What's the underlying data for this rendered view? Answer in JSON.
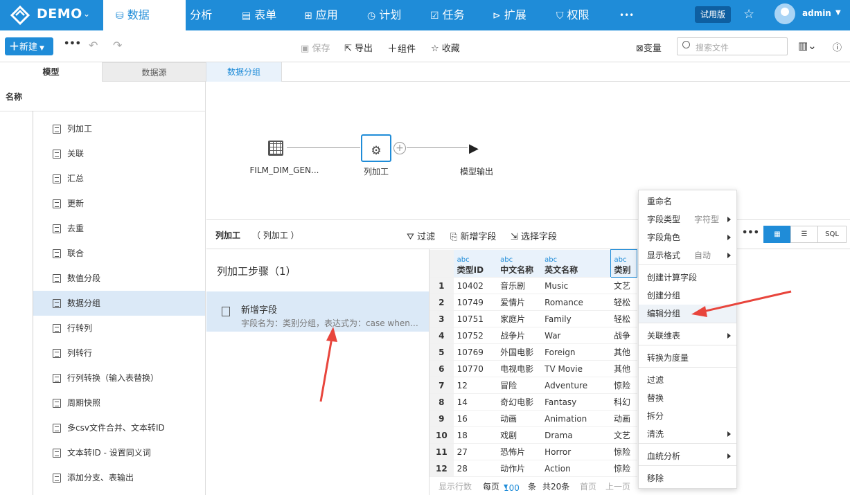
{
  "topbar": {
    "brand": "DEMO",
    "nav": [
      {
        "label": "数据",
        "icon": "database-icon",
        "glyph": "⛁"
      },
      {
        "label": "分析",
        "icon": "chart-icon",
        "glyph": "▥"
      },
      {
        "label": "表单",
        "icon": "form-icon",
        "glyph": "▤"
      },
      {
        "label": "应用",
        "icon": "apps-icon",
        "glyph": "⊞"
      },
      {
        "label": "计划",
        "icon": "clock-icon",
        "glyph": "◷"
      },
      {
        "label": "任务",
        "icon": "task-icon",
        "glyph": "☑"
      },
      {
        "label": "扩展",
        "icon": "extension-icon",
        "glyph": "⊳"
      },
      {
        "label": "权限",
        "icon": "shield-icon",
        "glyph": "⛉"
      }
    ],
    "more": "•••",
    "trial": "试用版",
    "user": "admin"
  },
  "toolbar": {
    "new_label": "新建",
    "more": "•••",
    "save": "保存",
    "export": "导出",
    "component": "组件",
    "favorite": "收藏",
    "variable": "变量",
    "search_placeholder": "搜索文件"
  },
  "left": {
    "tabs": [
      "模型",
      "数据源"
    ],
    "header": "名称",
    "nodes": [
      "列加工",
      "关联",
      "汇总",
      "更新",
      "去重",
      "联合",
      "数值分段",
      "数据分组",
      "行转列",
      "列转行",
      "行列转换（输入表替换）",
      "周期快照",
      "多csv文件合并、文本转ID",
      "文本转ID - 设置同义词",
      "添加分支、表输出"
    ],
    "selected_index": 7
  },
  "center": {
    "tab": "数据分组",
    "flow": {
      "source": "FILM_DIM_GEN...",
      "process": "列加工",
      "output": "模型输出"
    }
  },
  "colbar": {
    "title": "列加工",
    "name": "列加工",
    "filter": "过滤",
    "add_field": "新增字段",
    "select_field": "选择字段",
    "more": "•••",
    "sql": "SQL"
  },
  "steps": {
    "title": "列加工步骤（1）",
    "items": [
      {
        "title": "新增字段",
        "desc": "字段名为：类别分组，表达式为：case when ..."
      }
    ]
  },
  "grid": {
    "type_tag": "abc",
    "columns": [
      "类型ID",
      "中文名称",
      "英文名称",
      "类别"
    ],
    "rows": [
      [
        "1",
        "10402",
        "音乐剧",
        "Music",
        "文艺"
      ],
      [
        "2",
        "10749",
        "爱情片",
        "Romance",
        "轻松"
      ],
      [
        "3",
        "10751",
        "家庭片",
        "Family",
        "轻松"
      ],
      [
        "4",
        "10752",
        "战争片",
        "War",
        "战争"
      ],
      [
        "5",
        "10769",
        "外国电影",
        "Foreign",
        "其他"
      ],
      [
        "6",
        "10770",
        "电视电影",
        "TV Movie",
        "其他"
      ],
      [
        "7",
        "12",
        "冒险",
        "Adventure",
        "惊险"
      ],
      [
        "8",
        "14",
        "奇幻电影",
        "Fantasy",
        "科幻"
      ],
      [
        "9",
        "16",
        "动画",
        "Animation",
        "动画"
      ],
      [
        "10",
        "18",
        "戏剧",
        "Drama",
        "文艺"
      ],
      [
        "11",
        "27",
        "恐怖片",
        "Horror",
        "惊险"
      ],
      [
        "12",
        "28",
        "动作片",
        "Action",
        "惊险"
      ]
    ],
    "footer": {
      "rows_label": "显示行数",
      "per_page": "每页",
      "per_page_value": "100",
      "unit": "条",
      "total": "共20条",
      "first": "首页",
      "prev": "上一页"
    }
  },
  "context_menu": {
    "items": [
      {
        "label": "重命名"
      },
      {
        "label": "字段类型",
        "value": "字符型",
        "submenu": true
      },
      {
        "label": "字段角色",
        "submenu": true
      },
      {
        "label": "显示格式",
        "value": "自动",
        "submenu": true
      },
      {
        "label": "创建计算字段"
      },
      {
        "label": "创建分组"
      },
      {
        "label": "编辑分组"
      },
      {
        "label": "关联维表",
        "submenu": true
      },
      {
        "label": "转换为度量"
      },
      {
        "label": "过滤"
      },
      {
        "label": "替换"
      },
      {
        "label": "拆分"
      },
      {
        "label": "清洗",
        "submenu": true
      },
      {
        "label": "血统分析",
        "submenu": true
      },
      {
        "label": "移除"
      }
    ]
  },
  "colors": {
    "primary": "#1f8cd8",
    "selected_bg": "#dbe9f7",
    "annotation_arrow": "#e8453c"
  }
}
